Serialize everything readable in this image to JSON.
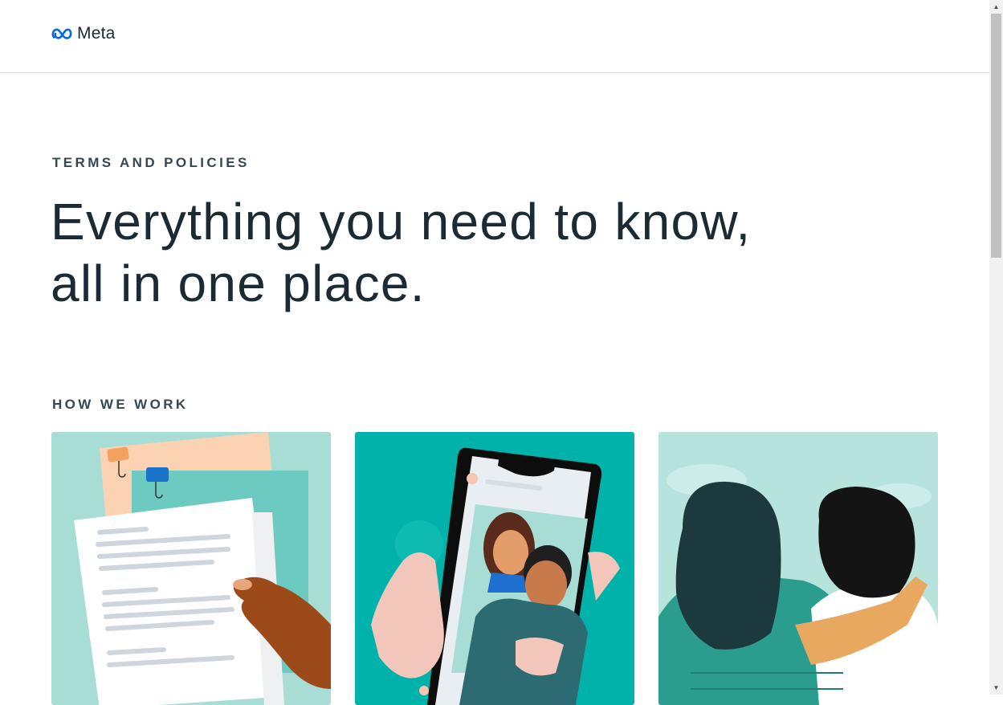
{
  "header": {
    "logo_text": "Meta",
    "logo_icon": "meta-infinity-icon"
  },
  "hero": {
    "eyebrow": "TERMS AND POLICIES",
    "headline_line1": "Everything you need to know,",
    "headline_line2": "all in one place."
  },
  "section": {
    "title": "HOW WE WORK"
  },
  "cards": [
    {
      "image": "documents-illustration"
    },
    {
      "image": "phone-selfie-illustration"
    },
    {
      "image": "two-friends-illustration"
    }
  ],
  "colors": {
    "brand_blue": "#0668e1",
    "text": "#1c2b33",
    "teal": "#00b2a9",
    "mint": "#a8ddd6"
  }
}
